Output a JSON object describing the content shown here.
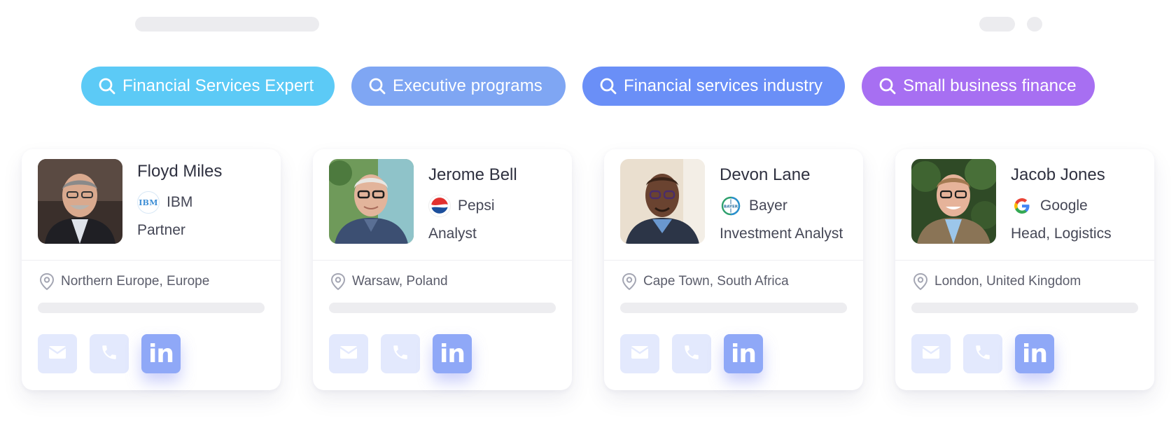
{
  "chips": [
    {
      "label": "Financial Services Expert",
      "color": "#5ccaf6"
    },
    {
      "label": "Executive programs",
      "color": "#7fa6f3"
    },
    {
      "label": "Financial services industry",
      "color": "#6a8ff7"
    },
    {
      "label": "Small business finance",
      "color": "#a76ff2"
    }
  ],
  "cards": [
    {
      "name": "Floyd Miles",
      "company": "IBM",
      "company_logo": "ibm-logo",
      "role": "Partner",
      "location": "Northern Europe, Europe"
    },
    {
      "name": "Jerome Bell",
      "company": "Pepsi",
      "company_logo": "pepsi-logo",
      "role": "Analyst",
      "location": "Warsaw, Poland"
    },
    {
      "name": "Devon Lane",
      "company": "Bayer",
      "company_logo": "bayer-logo",
      "role": "Investment Analyst",
      "location": "Cape Town, South Africa"
    },
    {
      "name": "Jacob Jones",
      "company": "Google",
      "company_logo": "google-logo",
      "role": "Head, Logistics",
      "location": "London, United Kingdom"
    }
  ],
  "actions": {
    "mail_icon": "mail-icon",
    "phone_icon": "phone-icon",
    "linkedin_label": "in"
  },
  "logos": {
    "ibm": "IBM",
    "bayer": "BAYER"
  },
  "colors": {
    "linkedin": "#8fa8f7",
    "action_bg": "#e3e9fd",
    "skeleton": "#ececef"
  }
}
